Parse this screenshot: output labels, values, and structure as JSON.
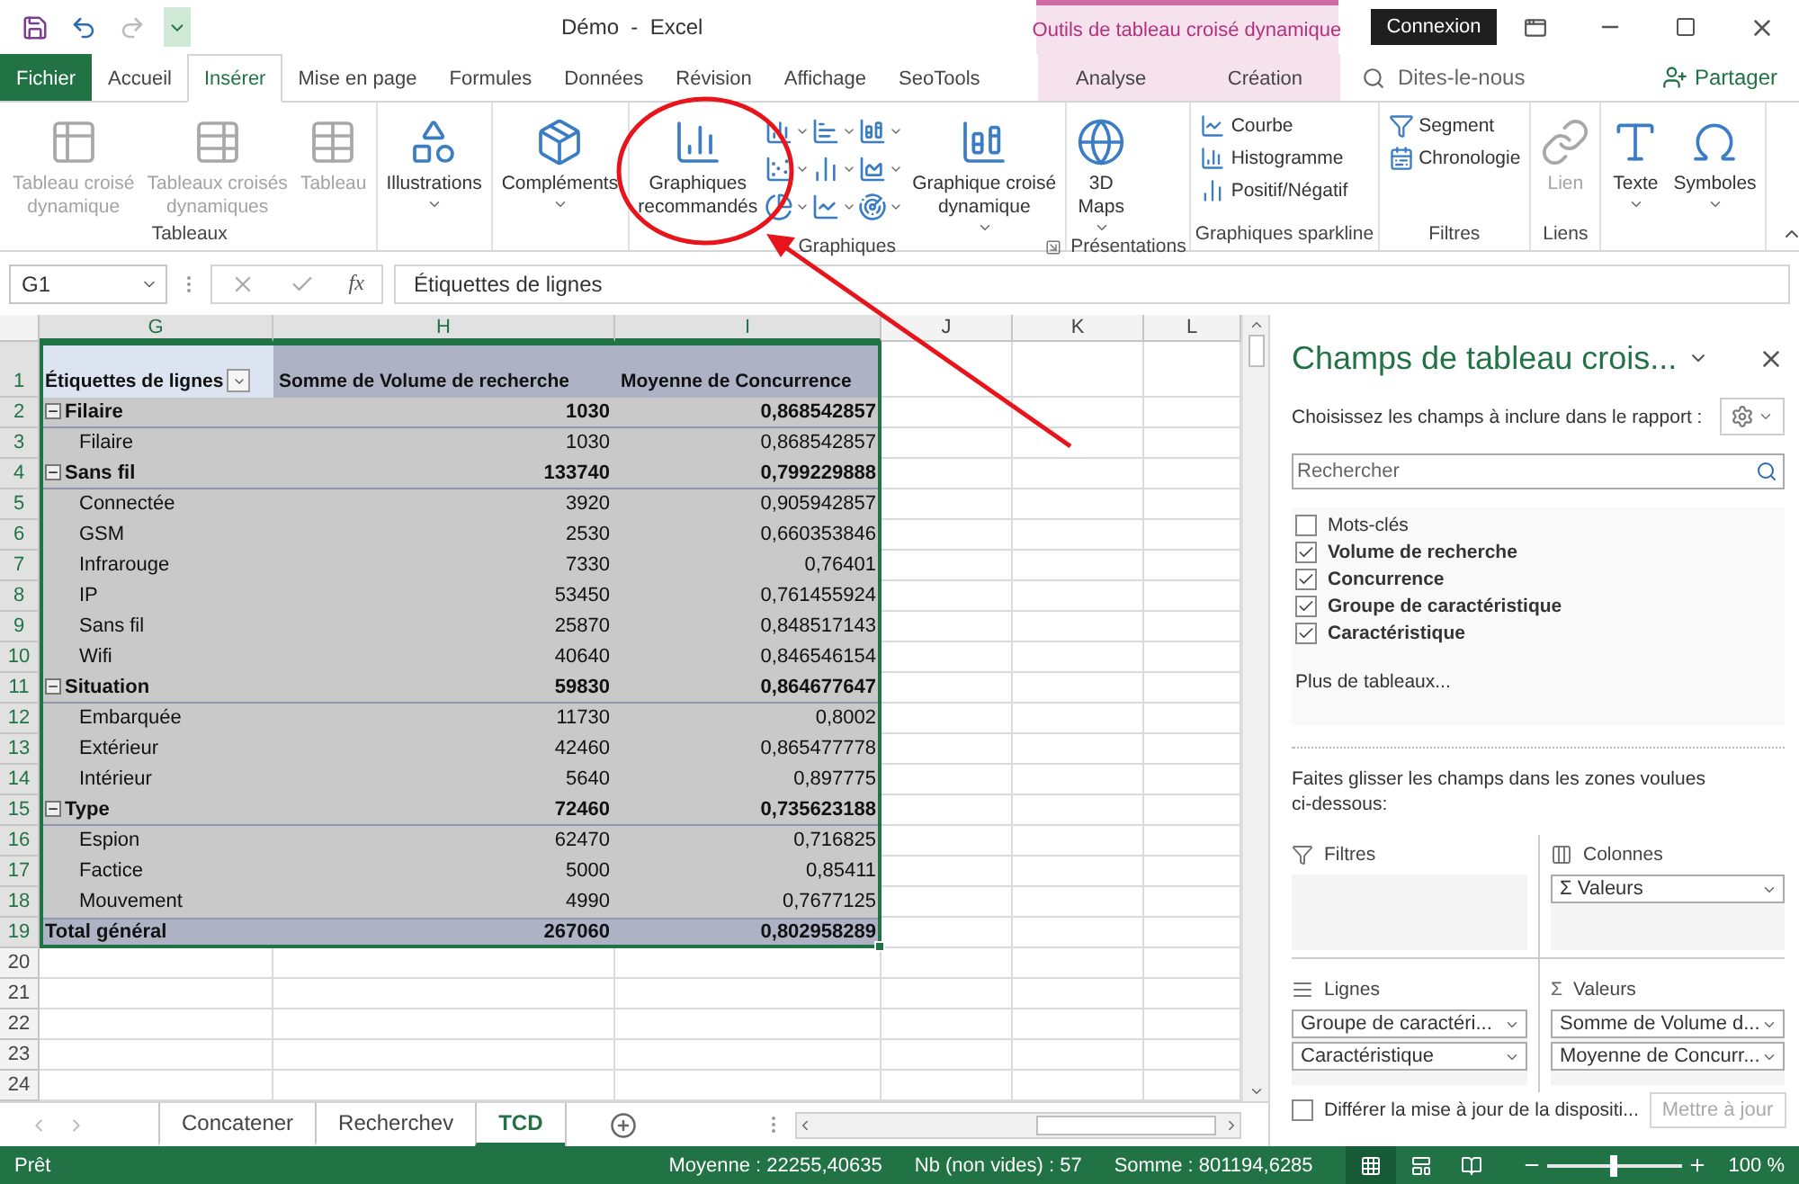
{
  "title_bar": {
    "title": "Démo  -  Excel",
    "context_group": "Outils de tableau croisé dynamique",
    "sign_in": "Connexion"
  },
  "tabs": [
    {
      "label": "Fichier",
      "kind": "file",
      "selected": false
    },
    {
      "label": "Accueil",
      "kind": "normal",
      "selected": false
    },
    {
      "label": "Insérer",
      "kind": "normal",
      "selected": true
    },
    {
      "label": "Mise en page",
      "kind": "normal",
      "selected": false
    },
    {
      "label": "Formules",
      "kind": "normal",
      "selected": false
    },
    {
      "label": "Données",
      "kind": "normal",
      "selected": false
    },
    {
      "label": "Révision",
      "kind": "normal",
      "selected": false
    },
    {
      "label": "Affichage",
      "kind": "normal",
      "selected": false
    },
    {
      "label": "SeoTools",
      "kind": "normal",
      "selected": false
    },
    {
      "label": "Analyse",
      "kind": "context",
      "selected": false
    },
    {
      "label": "Création",
      "kind": "context",
      "selected": false
    }
  ],
  "tell_me": {
    "placeholder": "Dites-le-nous"
  },
  "share": "Partager",
  "ribbon_groups": [
    {
      "label": "Tableaux",
      "items": [
        {
          "kind": "large",
          "label": "Tableau croisé\ndynamique",
          "disabled": true,
          "dropdown": false
        },
        {
          "kind": "large",
          "label": "Tableaux croisés\ndynamiques",
          "disabled": true,
          "dropdown": false
        },
        {
          "kind": "large",
          "label": "Tableau",
          "disabled": true,
          "dropdown": false
        }
      ]
    },
    {
      "items": [
        {
          "kind": "large",
          "label": "Illustrations",
          "disabled": false,
          "dropdown": true
        }
      ]
    },
    {
      "items": [
        {
          "kind": "large",
          "label": "Compléments",
          "disabled": false,
          "dropdown": true
        }
      ]
    },
    {
      "label": "Graphiques",
      "launcher": true,
      "items": [
        {
          "kind": "large",
          "label": "Graphiques\nrecommandés",
          "disabled": false,
          "dropdown": false
        },
        {
          "kind": "gallery"
        },
        {
          "kind": "large",
          "label": "Graphique croisé\ndynamique",
          "disabled": false,
          "dropdown": true
        }
      ]
    },
    {
      "label": "Présentations",
      "items": [
        {
          "kind": "large",
          "label": "3D\nMaps",
          "disabled": false,
          "dropdown": true
        }
      ]
    },
    {
      "label": "Graphiques sparkline",
      "items": [
        {
          "kind": "small",
          "label": "Courbe"
        },
        {
          "kind": "small",
          "label": "Histogramme"
        },
        {
          "kind": "small",
          "label": "Positif/Négatif"
        }
      ]
    },
    {
      "label": "Filtres",
      "items": [
        {
          "kind": "small",
          "label": "Segment"
        },
        {
          "kind": "small",
          "label": "Chronologie"
        }
      ]
    },
    {
      "label": "Liens",
      "items": [
        {
          "kind": "large",
          "label": "Lien",
          "disabled": true,
          "dropdown": false
        }
      ]
    },
    {
      "items": [
        {
          "kind": "large",
          "label": "Texte",
          "disabled": false,
          "dropdown": true
        },
        {
          "kind": "large",
          "label": "Symboles",
          "disabled": false,
          "dropdown": true
        }
      ]
    }
  ],
  "formula_bar": {
    "name_box": "G1",
    "function_symbol": "fx",
    "value": "Étiquettes de lignes"
  },
  "sheet": {
    "columns": [
      {
        "label": "G",
        "selected": true
      },
      {
        "label": "H",
        "selected": true
      },
      {
        "label": "I",
        "selected": true
      },
      {
        "label": "J",
        "selected": false
      },
      {
        "label": "K",
        "selected": false
      },
      {
        "label": "L",
        "selected": false
      }
    ],
    "rows": [
      {
        "label": "1",
        "selected": true
      },
      {
        "label": "2",
        "selected": true
      },
      {
        "label": "3",
        "selected": true
      },
      {
        "label": "4",
        "selected": true
      },
      {
        "label": "5",
        "selected": true
      },
      {
        "label": "6",
        "selected": true
      },
      {
        "label": "7",
        "selected": true
      },
      {
        "label": "8",
        "selected": true
      },
      {
        "label": "9",
        "selected": true
      },
      {
        "label": "10",
        "selected": true
      },
      {
        "label": "11",
        "selected": true
      },
      {
        "label": "12",
        "selected": true
      },
      {
        "label": "13",
        "selected": true
      },
      {
        "label": "14",
        "selected": true
      },
      {
        "label": "15",
        "selected": true
      },
      {
        "label": "16",
        "selected": true
      },
      {
        "label": "17",
        "selected": true
      },
      {
        "label": "18",
        "selected": true
      },
      {
        "label": "19",
        "selected": true
      },
      {
        "label": "20",
        "selected": false
      },
      {
        "label": "21",
        "selected": false
      },
      {
        "label": "22",
        "selected": false
      },
      {
        "label": "23",
        "selected": false
      },
      {
        "label": "24",
        "selected": false
      }
    ],
    "pivot": {
      "headers": [
        "Étiquettes de lignes",
        "Somme de Volume de recherche",
        "Moyenne de Concurrence"
      ],
      "rows": [
        {
          "kind": "group",
          "label": "Filaire",
          "expanded": true,
          "values": [
            "1030",
            "0,868542857"
          ]
        },
        {
          "kind": "item",
          "label": "Filaire",
          "values": [
            "1030",
            "0,868542857"
          ]
        },
        {
          "kind": "group",
          "label": "Sans fil",
          "expanded": true,
          "values": [
            "133740",
            "0,799229888"
          ]
        },
        {
          "kind": "item",
          "label": "Connectée",
          "values": [
            "3920",
            "0,905942857"
          ]
        },
        {
          "kind": "item",
          "label": "GSM",
          "values": [
            "2530",
            "0,660353846"
          ]
        },
        {
          "kind": "item",
          "label": "Infrarouge",
          "values": [
            "7330",
            "0,76401"
          ]
        },
        {
          "kind": "item",
          "label": "IP",
          "values": [
            "53450",
            "0,761455924"
          ]
        },
        {
          "kind": "item",
          "label": "Sans fil",
          "values": [
            "25870",
            "0,848517143"
          ]
        },
        {
          "kind": "item",
          "label": "Wifi",
          "values": [
            "40640",
            "0,846546154"
          ]
        },
        {
          "kind": "group",
          "label": "Situation",
          "expanded": true,
          "values": [
            "59830",
            "0,864677647"
          ]
        },
        {
          "kind": "item",
          "label": "Embarquée",
          "values": [
            "11730",
            "0,8002"
          ]
        },
        {
          "kind": "item",
          "label": "Extérieur",
          "values": [
            "42460",
            "0,865477778"
          ]
        },
        {
          "kind": "item",
          "label": "Intérieur",
          "values": [
            "5640",
            "0,897775"
          ]
        },
        {
          "kind": "group",
          "label": "Type",
          "expanded": true,
          "values": [
            "72460",
            "0,735623188"
          ]
        },
        {
          "kind": "item",
          "label": "Espion",
          "values": [
            "62470",
            "0,716825"
          ]
        },
        {
          "kind": "item",
          "label": "Factice",
          "values": [
            "5000",
            "0,85411"
          ]
        },
        {
          "kind": "item",
          "label": "Mouvement",
          "values": [
            "4990",
            "0,7677125"
          ]
        },
        {
          "kind": "total",
          "label": "Total général",
          "values": [
            "267060",
            "0,802958289"
          ]
        }
      ]
    }
  },
  "sheet_tabs": [
    {
      "label": "Concatener",
      "selected": false
    },
    {
      "label": "Recherchev",
      "selected": false
    },
    {
      "label": "TCD",
      "selected": true
    }
  ],
  "pane": {
    "title": "Champs de tableau crois...",
    "subtitle": "Choisissez les champs à inclure dans le rapport :",
    "search": {
      "placeholder": "Rechercher"
    },
    "fields": [
      {
        "label": "Mots-clés",
        "checked": false
      },
      {
        "label": "Volume de recherche",
        "checked": true
      },
      {
        "label": "Concurrence",
        "checked": true
      },
      {
        "label": "Groupe de caractéristique",
        "checked": true
      },
      {
        "label": "Caractéristique",
        "checked": true
      }
    ],
    "more_tables": "Plus de tableaux...",
    "hint": "Faites glisser les champs dans les zones voulues\nci-dessous:",
    "areas": [
      {
        "kind": "filters",
        "label": "Filtres"
      },
      {
        "kind": "columns",
        "label": "Colonnes",
        "items": [
          {
            "label": "Valeurs",
            "symbol": "Σ"
          }
        ]
      },
      {
        "kind": "rows",
        "label": "Lignes",
        "items": [
          {
            "label": "Groupe de caractéri..."
          },
          {
            "label": "Caractéristique"
          }
        ]
      },
      {
        "kind": "values",
        "label": "Valeurs",
        "symbol": "Σ",
        "items": [
          {
            "label": "Somme de Volume d..."
          },
          {
            "label": "Moyenne de Concurr..."
          }
        ]
      }
    ],
    "defer": {
      "label": "Différer la mise à jour de la dispositi...",
      "checked": false
    },
    "update_button": {
      "label": "Mettre à jour",
      "disabled": true
    }
  },
  "status": {
    "ready": "Prêt",
    "stats": [
      "Moyenne : 22255,40635",
      "Nb (non vides) : 57",
      "Somme : 801194,6285"
    ],
    "views": [
      {
        "selected": true
      },
      {
        "selected": false
      },
      {
        "selected": false
      }
    ],
    "zoom": {
      "level": 0.5,
      "label": "100 %"
    }
  }
}
